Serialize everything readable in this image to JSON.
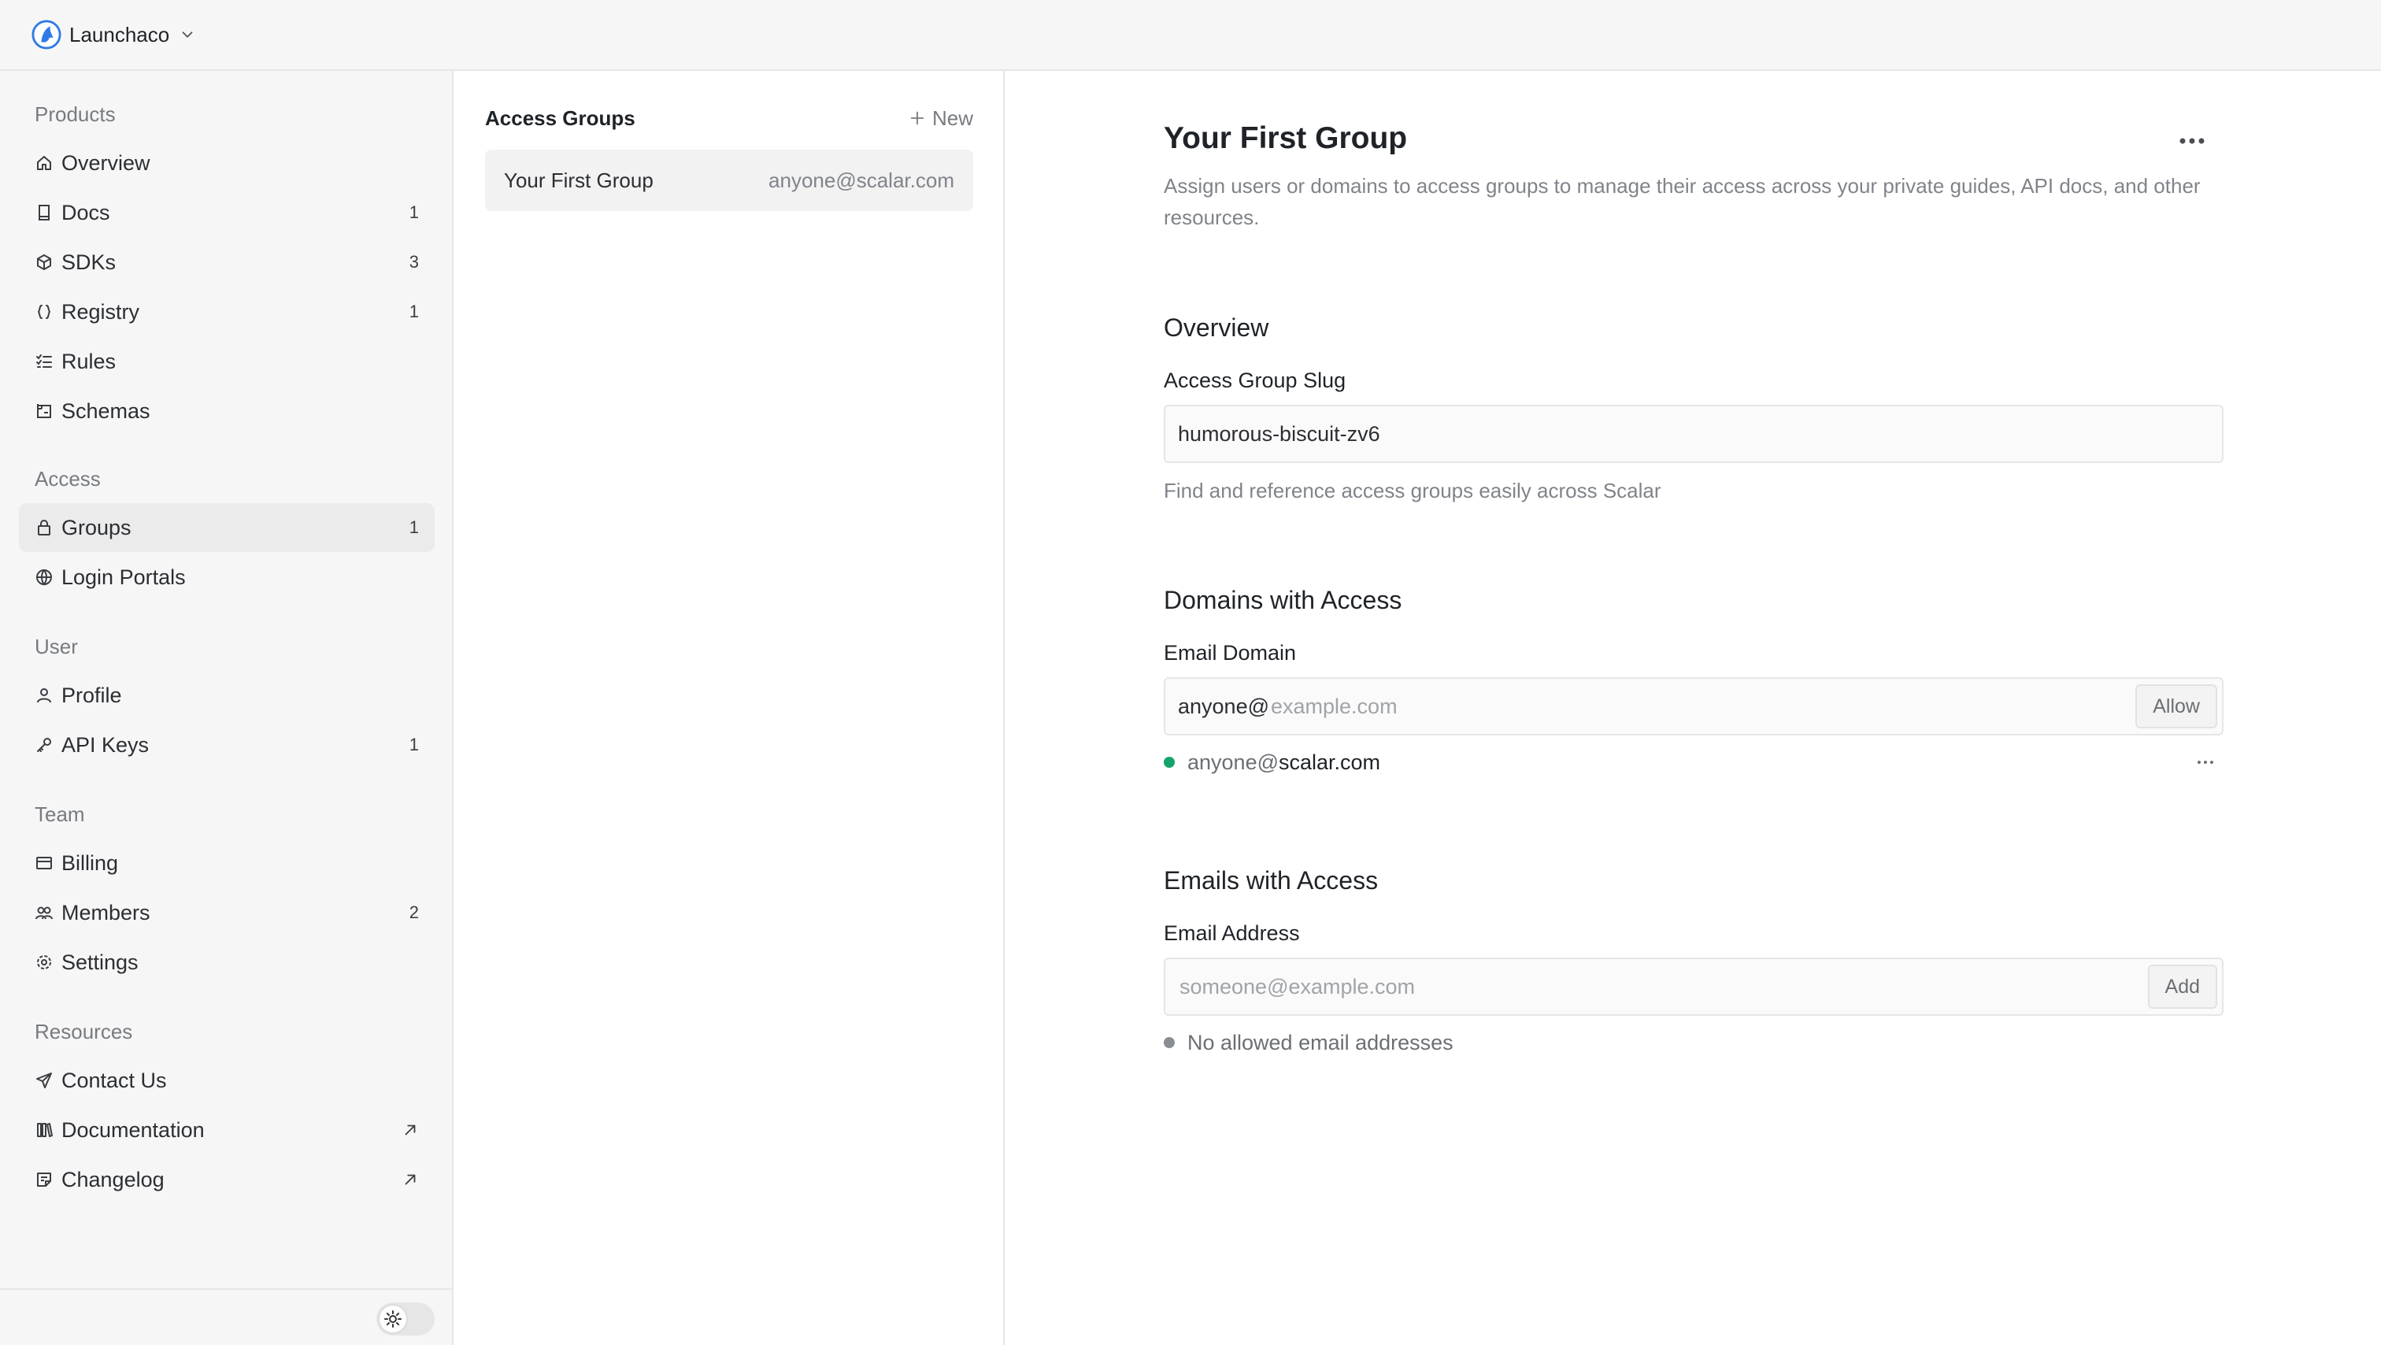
{
  "header": {
    "org_name": "Launchaco"
  },
  "sidebar": {
    "sections": {
      "products": "Products",
      "access": "Access",
      "user": "User",
      "team": "Team",
      "resources": "Resources"
    },
    "items": {
      "overview": {
        "label": "Overview",
        "icon": "home-icon"
      },
      "docs": {
        "label": "Docs",
        "count": "1",
        "icon": "book-icon"
      },
      "sdks": {
        "label": "SDKs",
        "count": "3",
        "icon": "package-icon"
      },
      "registry": {
        "label": "Registry",
        "count": "1",
        "icon": "braces-icon"
      },
      "rules": {
        "label": "Rules",
        "icon": "list-check-icon"
      },
      "schemas": {
        "label": "Schemas",
        "icon": "schema-icon"
      },
      "groups": {
        "label": "Groups",
        "count": "1",
        "icon": "lock-icon"
      },
      "login_portals": {
        "label": "Login Portals",
        "icon": "globe-icon"
      },
      "profile": {
        "label": "Profile",
        "icon": "user-icon"
      },
      "api_keys": {
        "label": "API Keys",
        "count": "1",
        "icon": "key-icon"
      },
      "billing": {
        "label": "Billing",
        "icon": "card-icon"
      },
      "members": {
        "label": "Members",
        "count": "2",
        "icon": "users-icon"
      },
      "settings": {
        "label": "Settings",
        "icon": "gear-icon"
      },
      "contact": {
        "label": "Contact Us",
        "icon": "send-icon"
      },
      "documentation": {
        "label": "Documentation",
        "icon": "library-icon"
      },
      "changelog": {
        "label": "Changelog",
        "icon": "note-icon"
      }
    }
  },
  "groups_panel": {
    "title": "Access Groups",
    "new_label": "New",
    "groups": [
      {
        "name": "Your First Group",
        "email": "anyone@scalar.com"
      }
    ]
  },
  "detail": {
    "title": "Your First Group",
    "description": "Assign users or domains to access groups to manage their access across your private guides, API docs, and other resources.",
    "overview": {
      "heading": "Overview",
      "slug_label": "Access Group Slug",
      "slug_value": "humorous-biscuit-zv6",
      "slug_hint": "Find and reference access groups easily across Scalar"
    },
    "domains": {
      "heading": "Domains with Access",
      "field_label": "Email Domain",
      "prefix": "anyone@",
      "placeholder": "example.com",
      "button": "Allow",
      "entries": [
        {
          "prefix": "anyone@",
          "domain": "scalar.com"
        }
      ]
    },
    "emails": {
      "heading": "Emails with Access",
      "field_label": "Email Address",
      "placeholder": "someone@example.com",
      "button": "Add",
      "empty": "No allowed email addresses"
    }
  },
  "colors": {
    "accent": "#2f7ae5",
    "status_green": "#16a36a"
  }
}
